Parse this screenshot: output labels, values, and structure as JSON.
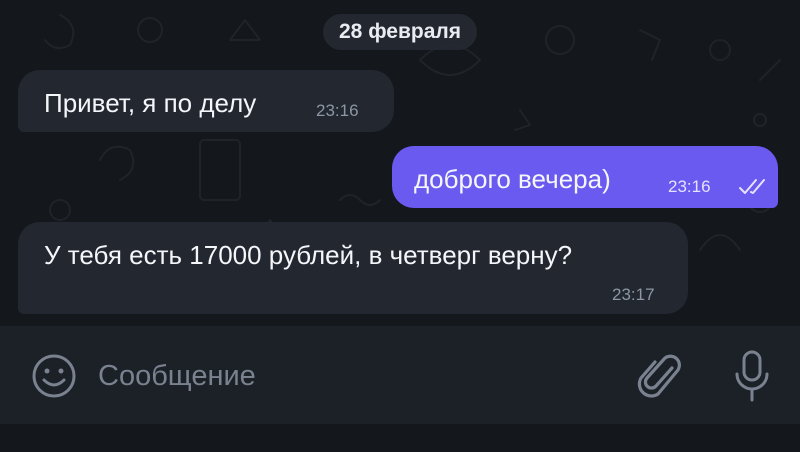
{
  "chat": {
    "date_separator": "28 февраля",
    "messages": [
      {
        "direction": "incoming",
        "text": "Привет, я по делу",
        "time": "23:16"
      },
      {
        "direction": "outgoing",
        "text": "доброго вечера)",
        "time": "23:16",
        "status_icon": "double-check-icon"
      },
      {
        "direction": "incoming",
        "text": "У тебя есть 17000 рублей, в четверг верну?",
        "time": "23:17"
      }
    ]
  },
  "composer": {
    "placeholder": "Сообщение",
    "value": "",
    "emoji_icon": "smiley-icon",
    "attach_icon": "paperclip-icon",
    "mic_icon": "microphone-icon"
  },
  "colors": {
    "background": "#14171c",
    "incoming_bubble": "#222730",
    "outgoing_bubble": "#6a5af0",
    "composer_bar": "#1c2027"
  }
}
